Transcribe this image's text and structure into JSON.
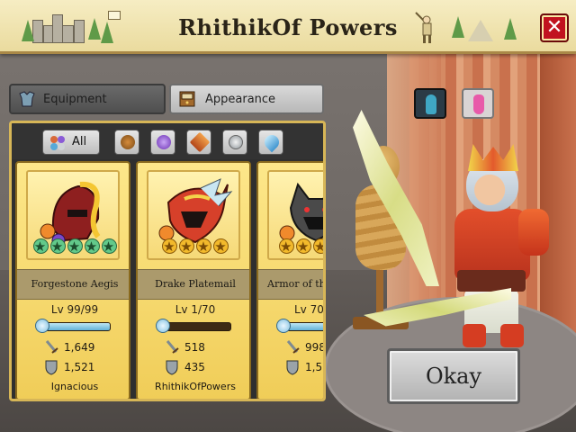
{
  "header": {
    "title": "RhithikOf Powers",
    "close_label": "✕"
  },
  "tabs": [
    {
      "label": "Equipment",
      "icon": "armor-icon",
      "active": false
    },
    {
      "label": "Appearance",
      "icon": "wardrobe-icon",
      "active": true
    }
  ],
  "filters": {
    "all_label": "All",
    "items": [
      "all",
      "earth",
      "arcane",
      "fire",
      "air",
      "water"
    ]
  },
  "items": [
    {
      "name": "Forgestone Aegis",
      "level": "Lv 99/99",
      "xp_fraction": 1.0,
      "attack": "1,649",
      "defense": "1,521",
      "owner": "Ignacious",
      "stars": 5,
      "star_color": "#62c98a"
    },
    {
      "name": "Drake Platemail",
      "level": "Lv 1/70",
      "xp_fraction": 0.0,
      "attack": "518",
      "defense": "435",
      "owner": "RhithikOfPowers",
      "stars": 4,
      "star_color": "#f2b92b"
    },
    {
      "name": "Armor of th",
      "level": "Lv 70/",
      "xp_fraction": 1.0,
      "attack": "998",
      "defense": "1,5",
      "owner": "",
      "stars": 4,
      "star_color": "#f2b92b"
    }
  ],
  "gender": {
    "options": [
      "male",
      "female"
    ],
    "selected": "male"
  },
  "okay_label": "Okay",
  "colors": {
    "panel_border": "#d7b657",
    "card_bg": "#fde78a",
    "close_bg": "#c1121f",
    "banner_bg": "#f6edc3"
  }
}
